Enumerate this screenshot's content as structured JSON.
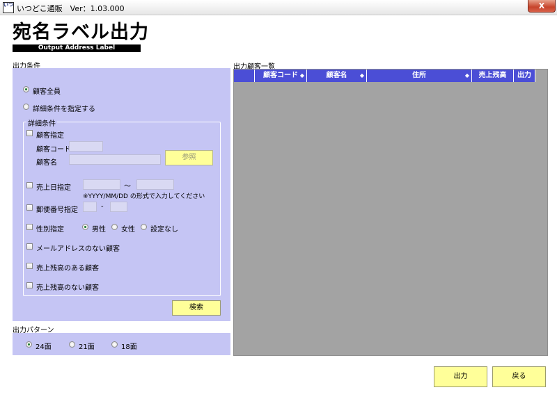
{
  "window": {
    "icon_text": "いつ",
    "title": "いつどこ通販　Ver：1.03.000",
    "close": "X"
  },
  "header": {
    "title": "宛名ラベル出力",
    "subtitle": "Output Address Label"
  },
  "conditions": {
    "label": "出力条件",
    "all_customers": "顧客全員",
    "specify_detail": "詳細条件を指定する",
    "detail_legend": "詳細条件",
    "customer_specify": "顧客指定",
    "customer_code_label": "顧客コード",
    "customer_name_label": "顧客名",
    "browse_button": "参照",
    "sales_date_label": "売上日指定",
    "date_tilde": "～",
    "date_hint": "※YYYY/MM/DD の形式で入力してください",
    "postal_label": "郵便番号指定",
    "postal_dash": "-",
    "gender_label": "性別指定",
    "gender_male": "男性",
    "gender_female": "女性",
    "gender_none": "設定なし",
    "no_email": "メールアドレスのない顧客",
    "has_balance": "売上残高のある顧客",
    "no_balance": "売上残高のない顧客",
    "search_button": "検索"
  },
  "pattern": {
    "label": "出力パターン",
    "opt24": "24面",
    "opt21": "21面",
    "opt18": "18面"
  },
  "list": {
    "label": "出力顧客一覧",
    "columns": [
      "",
      "顧客コード",
      "顧客名",
      "住所",
      "売上残高",
      "出力"
    ]
  },
  "footer": {
    "output_button": "出力",
    "back_button": "戻る"
  }
}
